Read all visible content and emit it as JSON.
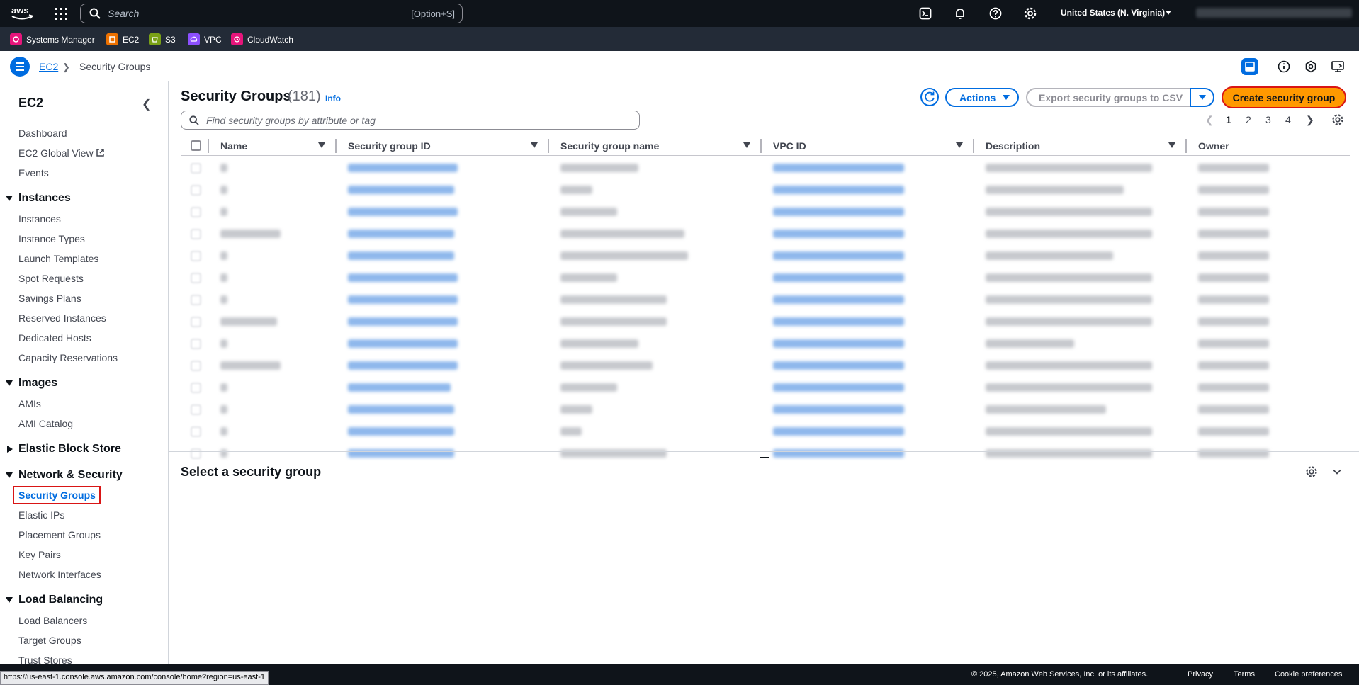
{
  "topnav": {
    "search_placeholder": "Search",
    "search_shortcut": "[Option+S]",
    "region": "United States (N. Virginia)"
  },
  "favorites": [
    {
      "label": "Systems Manager",
      "color": "#e7157b",
      "icon": "systems-manager-icon"
    },
    {
      "label": "EC2",
      "color": "#ed7100",
      "icon": "ec2-icon"
    },
    {
      "label": "S3",
      "color": "#7aa116",
      "icon": "s3-icon"
    },
    {
      "label": "VPC",
      "color": "#8c4fff",
      "icon": "vpc-icon"
    },
    {
      "label": "CloudWatch",
      "color": "#e7157b",
      "icon": "cloudwatch-icon"
    }
  ],
  "breadcrumb": {
    "root": "EC2",
    "current": "Security Groups"
  },
  "sidebar": {
    "title": "EC2",
    "top_items": [
      "Dashboard",
      "EC2 Global View",
      "Events"
    ],
    "sections": [
      {
        "label": "Instances",
        "expanded": true,
        "items": [
          "Instances",
          "Instance Types",
          "Launch Templates",
          "Spot Requests",
          "Savings Plans",
          "Reserved Instances",
          "Dedicated Hosts",
          "Capacity Reservations"
        ]
      },
      {
        "label": "Images",
        "expanded": true,
        "items": [
          "AMIs",
          "AMI Catalog"
        ]
      },
      {
        "label": "Elastic Block Store",
        "expanded": false,
        "items": []
      },
      {
        "label": "Network & Security",
        "expanded": true,
        "items": [
          "Security Groups",
          "Elastic IPs",
          "Placement Groups",
          "Key Pairs",
          "Network Interfaces"
        ]
      },
      {
        "label": "Load Balancing",
        "expanded": true,
        "items": [
          "Load Balancers",
          "Target Groups",
          "Trust Stores"
        ]
      }
    ],
    "active_item": "Security Groups"
  },
  "main": {
    "title": "Security Groups",
    "count": "(181)",
    "info": "Info",
    "actions_label": "Actions",
    "export_label": "Export security groups to CSV",
    "create_label": "Create security group",
    "filter_placeholder": "Find security groups by attribute or tag",
    "pages": [
      "1",
      "2",
      "3",
      "4"
    ],
    "current_page": "1",
    "columns": [
      "Name",
      "Security group ID",
      "Security group name",
      "VPC ID",
      "Description",
      "Owner"
    ],
    "detail_title": "Select a security group"
  },
  "footer": {
    "copyright": "© 2025, Amazon Web Services, Inc. or its affiliates.",
    "links": [
      "Privacy",
      "Terms",
      "Cookie preferences"
    ],
    "status_url": "https://us-east-1.console.aws.amazon.com/console/home?region=us-east-1"
  },
  "colors": {
    "accent": "#006ce0",
    "primary_button": "#ff9900",
    "highlight_border": "#d91515"
  }
}
